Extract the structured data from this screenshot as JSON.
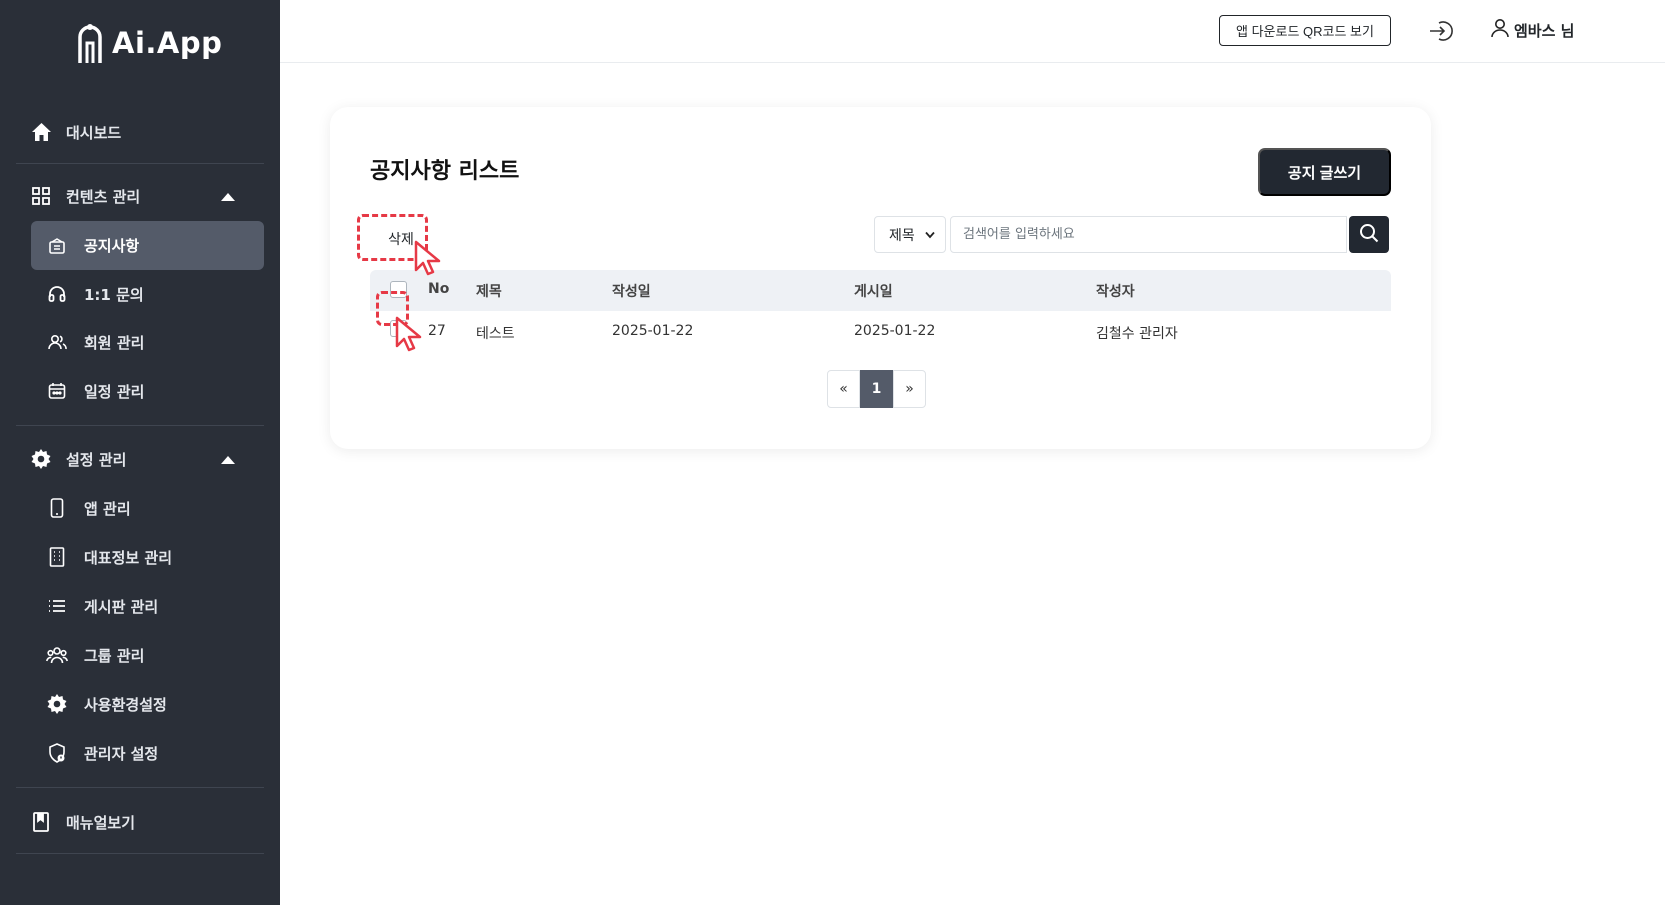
{
  "app": {
    "logo_text": "Ai.App"
  },
  "sidebar": {
    "dashboard": "대시보드",
    "contents_group": "컨텐츠 관리",
    "contents_items": [
      {
        "label": "공지사항",
        "icon": "notice-icon",
        "active": true
      },
      {
        "label": "1:1 문의",
        "icon": "headset-icon"
      },
      {
        "label": "회원 관리",
        "icon": "users-icon"
      },
      {
        "label": "일정 관리",
        "icon": "calendar-icon"
      }
    ],
    "settings_group": "설정 관리",
    "settings_items": [
      {
        "label": "앱 관리",
        "icon": "mobile-icon"
      },
      {
        "label": "대표정보 관리",
        "icon": "building-icon"
      },
      {
        "label": "게시판 관리",
        "icon": "list-icon"
      },
      {
        "label": "그룹 관리",
        "icon": "group-icon"
      },
      {
        "label": "사용환경설정",
        "icon": "gear-icon"
      },
      {
        "label": "관리자 설정",
        "icon": "admin-shield-icon"
      }
    ],
    "manual": "매뉴얼보기"
  },
  "header": {
    "qr_button": "앱 다운로드 QR코드 보기",
    "user_name": "엠바스 님"
  },
  "main": {
    "title": "공지사항 리스트",
    "write_button": "공지 글쓰기",
    "delete_button": "삭제",
    "search_select": "제목",
    "search_placeholder": "검색어를 입력하세요",
    "columns": [
      "No",
      "제목",
      "작성일",
      "게시일",
      "작성자"
    ],
    "rows": [
      {
        "no": "27",
        "title": "테스트",
        "created": "2025-01-22",
        "posted": "2025-01-22",
        "author": "김철수 관리자"
      }
    ],
    "pagination": {
      "prev": "«",
      "current": "1",
      "next": "»"
    }
  },
  "colors": {
    "sidebar_bg": "#2a2f38",
    "active_bg": "#545b69",
    "primary_dark": "#222831",
    "annotation_red": "#e63946"
  }
}
